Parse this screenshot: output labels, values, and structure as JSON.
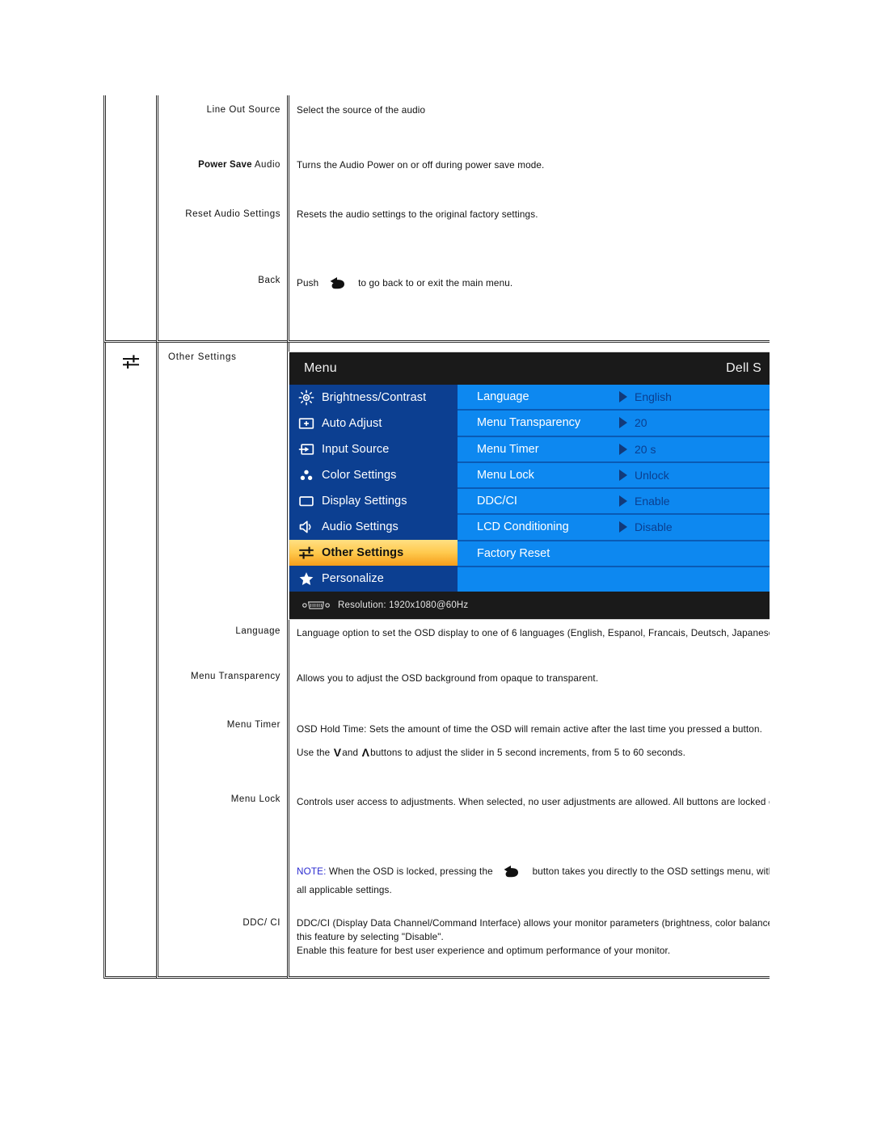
{
  "audio_section": {
    "rows": [
      {
        "label_plain": "Line Out Source",
        "label_bold": "",
        "desc": "Select the source of the audio"
      },
      {
        "label_plain": " Audio",
        "label_bold": "Power Save",
        "desc": "Turns the Audio Power on or off during power save mode."
      },
      {
        "label_plain": "Reset Audio Settings",
        "label_bold": "",
        "desc": "Resets the audio settings to the original factory settings."
      },
      {
        "label_plain": "Back",
        "label_bold": "",
        "desc_before": "Push",
        "desc_after": "to go back to or exit the main menu."
      }
    ]
  },
  "other_settings_section": {
    "title": "Other Settings",
    "icon": "sliders-icon",
    "osd": {
      "header": {
        "title": "Menu",
        "model": "Dell S"
      },
      "left_items": [
        {
          "label": "Brightness/Contrast",
          "icon": "brightness-icon",
          "selected": false
        },
        {
          "label": "Auto Adjust",
          "icon": "auto-adjust-icon",
          "selected": false
        },
        {
          "label": "Input Source",
          "icon": "input-source-icon",
          "selected": false
        },
        {
          "label": "Color Settings",
          "icon": "color-settings-icon",
          "selected": false
        },
        {
          "label": "Display Settings",
          "icon": "display-settings-icon",
          "selected": false
        },
        {
          "label": "Audio Settings",
          "icon": "speaker-icon",
          "selected": false
        },
        {
          "label": "Other Settings",
          "icon": "sliders-icon",
          "selected": true
        },
        {
          "label": "Personalize",
          "icon": "star-icon",
          "selected": false
        }
      ],
      "right_rows": [
        {
          "label": "Language",
          "value": "English"
        },
        {
          "label": "Menu Transparency",
          "value": "20"
        },
        {
          "label": "Menu Timer",
          "value": "20 s"
        },
        {
          "label": "Menu Lock",
          "value": "Unlock"
        },
        {
          "label": "DDC/CI",
          "value": "Enable"
        },
        {
          "label": "LCD Conditioning",
          "value": "Disable"
        },
        {
          "label": "Factory Reset",
          "value": ""
        },
        {
          "label": "",
          "value": ""
        }
      ],
      "footer": {
        "icon": "vga-connector-icon",
        "text": "Resolution:  1920x1080@60Hz"
      }
    },
    "rows": [
      {
        "label": "Language",
        "lines": [
          "Language option to set the OSD display to one of 6 languages (English, Espanol, Francais, Deutsch, Japanese, Simpl"
        ]
      },
      {
        "label": "Menu Transparency",
        "lines": [
          "Allows you to adjust the OSD background from opaque to transparent."
        ]
      },
      {
        "label": "Menu Timer",
        "lines": [
          "OSD Hold Time: Sets the amount of time the OSD will remain active after the last time you pressed a button."
        ],
        "slider_line": {
          "before": "Use the",
          "down": "V",
          "mid": "and",
          "up": "Λ",
          "after": "buttons to adjust the slider in 5 second increments, from 5 to 60 seconds."
        }
      },
      {
        "label": "Menu Lock",
        "lines": [
          "Controls user access to adjustments. When selected, no user adjustments are allowed. All buttons are locked excep"
        ],
        "note": {
          "tag": "NOTE:",
          "before": "When the OSD is locked, pressing the",
          "icon": "back-arrow-icon",
          "after": "button takes you directly to the OSD settings menu, with 'OSD Lo",
          "second_line": "all applicable settings."
        }
      },
      {
        "label": "DDC/ CI",
        "lines": [
          "DDC/CI (Display Data Channel/Command Interface) allows your monitor parameters (brightness, color balance,  etc.",
          "this feature by selecting \"Disable\".",
          "Enable this feature for best user experience and optimum performance of your monitor."
        ]
      }
    ]
  }
}
